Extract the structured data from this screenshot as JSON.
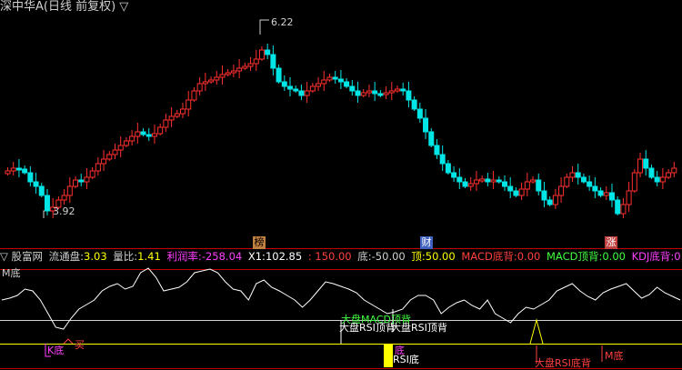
{
  "title": "深中华A(日线 前复权) ▽",
  "colors": {
    "up": "#ff3030",
    "down": "#00e5e5",
    "frame": "#c00000",
    "text": "#d0d0d0"
  },
  "price_high_label": "6.22",
  "price_low_label": "3.92",
  "markers": [
    {
      "text": "榜",
      "bg": "#c08040",
      "color": "#000"
    },
    {
      "text": "财",
      "bg": "#4060c0",
      "color": "#fff"
    },
    {
      "text": "涨",
      "bg": "#c04040",
      "color": "#fff"
    }
  ],
  "info": {
    "indicator_name": "▽ 股富网",
    "float_label": "流通盘:",
    "float_value": "3.03",
    "vr_label": "量比:",
    "vr_value": "1.41",
    "profit_label": "利润率:",
    "profit_value": "-258.04",
    "x1_label": "X1:",
    "x1_value": "102.85",
    "x1b_value": ": 150.00",
    "bottom_label": "底:",
    "bottom_value": "-50.00",
    "top_label": "顶:",
    "top_value": "50.00",
    "macd_bottom_label": "MACD底背:",
    "macd_bottom_value": "0.00",
    "macd_top_label": "MACD顶背:",
    "macd_top_value": "0.00",
    "kdj_label": "KDJ底背:",
    "kdj_value": "0.00"
  },
  "annotations": {
    "m_bottom_top": "M底",
    "macd_top_back": "大盘MACD顶背",
    "rsi_top_back": "大盘RSI顶背",
    "rsi_top_back2": "大盘RSI顶背",
    "k_bottom": "K底",
    "buy": "买",
    "rsi_bottom": "RSI底",
    "bottom": "底",
    "rsi_bottom_back": "大盘RSI底背",
    "m_bottom": "M底"
  }
}
